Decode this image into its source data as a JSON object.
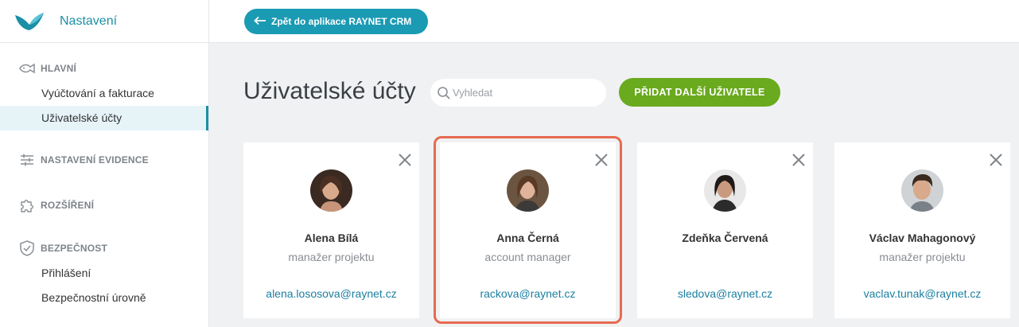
{
  "sidebar": {
    "title": "Nastavení",
    "sections": {
      "main": {
        "label": "HLAVNÍ",
        "icon": "fish-icon"
      },
      "evidence": {
        "label": "NASTAVENÍ EVIDENCE",
        "icon": "sliders-icon"
      },
      "extensions": {
        "label": "ROZŠÍŘENÍ",
        "icon": "puzzle-icon"
      },
      "security": {
        "label": "BEZPEČNOST",
        "icon": "shield-icon"
      }
    },
    "items": {
      "billing": "Vyúčtování a fakturace",
      "users": "Uživatelské účty",
      "login": "Přihlášení",
      "security_levels": "Bezpečnostní úrovně"
    }
  },
  "topbar": {
    "back_label": "Zpět do aplikace RAYNET CRM"
  },
  "main": {
    "title": "Uživatelské účty",
    "search_placeholder": "Vyhledat",
    "add_label": "PŘIDAT DALŠÍ UŽIVATELE"
  },
  "users": [
    {
      "name": "Alena Bílá",
      "role": "manažer projektu",
      "email": "alena.lososova@raynet.cz"
    },
    {
      "name": "Anna Černá",
      "role": "account manager",
      "email": "rackova@raynet.cz"
    },
    {
      "name": "Zdeňka Červená",
      "role": "",
      "email": "sledova@raynet.cz"
    },
    {
      "name": "Václav Mahagonový",
      "role": "manažer projektu",
      "email": "vaclav.tunak@raynet.cz"
    }
  ],
  "colors": {
    "brand": "#1b8fa5",
    "back_button": "#1b9ab3",
    "add_button": "#6aaa1e",
    "email_link": "#1b7fa0",
    "highlight": "#e86a4f"
  }
}
